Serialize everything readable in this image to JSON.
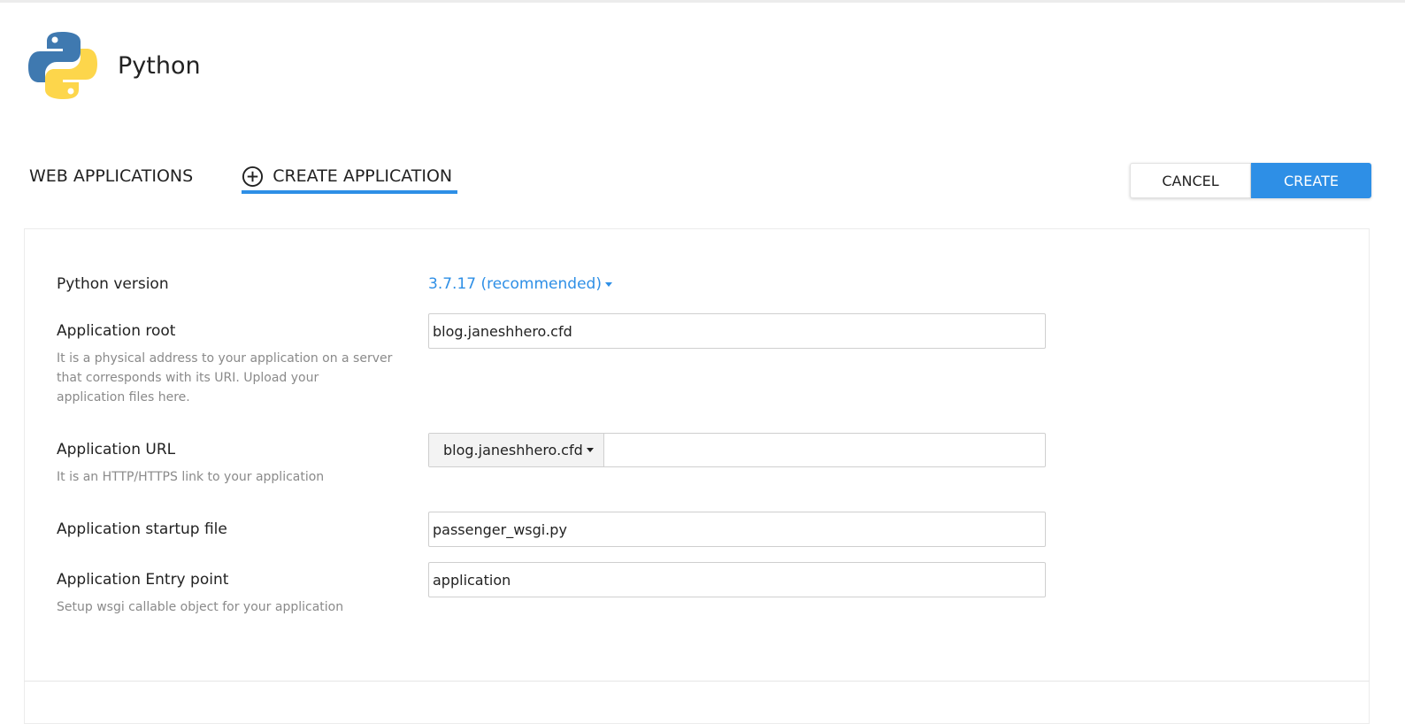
{
  "header": {
    "title": "Python",
    "logo_icon": "python-logo"
  },
  "tabs": [
    {
      "label": "WEB APPLICATIONS",
      "active": false
    },
    {
      "label": "CREATE APPLICATION",
      "active": true,
      "icon": "plus-circle-icon"
    }
  ],
  "actions": {
    "cancel_label": "CANCEL",
    "create_label": "CREATE"
  },
  "colors": {
    "accent": "#2e8fe6",
    "hint_text": "#8a8a8a"
  },
  "form": {
    "python_version": {
      "label": "Python version",
      "value": "3.7.17 (recommended)"
    },
    "app_root": {
      "label": "Application root",
      "value": "blog.janeshhero.cfd",
      "hint_lines": [
        "It is a physical address to your application on a server",
        "that corresponds with its URI. Upload your",
        "application files here."
      ]
    },
    "app_url": {
      "label": "Application URL",
      "domain": "blog.janeshhero.cfd",
      "path": "",
      "hint": "It is an HTTP/HTTPS link to your application"
    },
    "startup_file": {
      "label": "Application startup file",
      "value": "passenger_wsgi.py"
    },
    "entry_point": {
      "label": "Application Entry point",
      "value": "application",
      "hint": "Setup wsgi callable object for your application"
    }
  }
}
